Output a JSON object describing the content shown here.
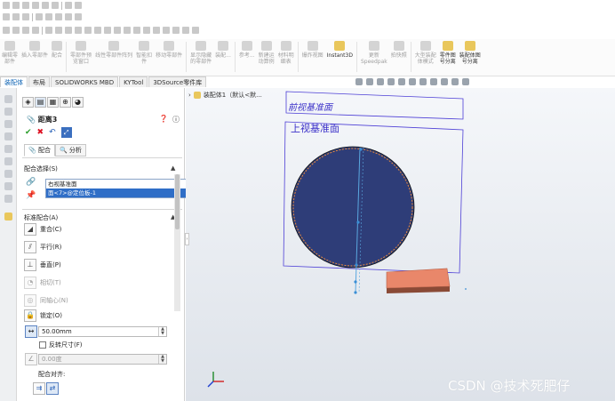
{
  "ribbon": {
    "items": [
      {
        "label": "编辑零\n部件",
        "on": false
      },
      {
        "label": "插入零部件",
        "on": false
      },
      {
        "label": "配合",
        "on": false
      },
      {
        "label": "零部件预\n览窗口",
        "on": false
      },
      {
        "label": "线性零部件阵列",
        "on": false
      },
      {
        "label": "智能扣\n件",
        "on": false
      },
      {
        "label": "移动零部件",
        "on": false
      },
      {
        "label": "显示隐藏\n的零部件",
        "on": false
      },
      {
        "label": "装配...",
        "on": false
      },
      {
        "label": "参考...",
        "on": false
      },
      {
        "label": "新建运\n动算例",
        "on": false
      },
      {
        "label": "材料明\n细表",
        "on": false
      },
      {
        "label": "爆炸视图",
        "on": false
      },
      {
        "label": "Instant3D",
        "on": true
      },
      {
        "label": "更新\nSpeedpak",
        "on": false
      },
      {
        "label": "拍快照",
        "on": false
      },
      {
        "label": "大型装配\n体模式",
        "on": false
      },
      {
        "label": "零件图\n号分离",
        "on": true
      },
      {
        "label": "装配体图\n号分离",
        "on": true
      }
    ]
  },
  "tabs": [
    {
      "label": "装配体",
      "active": true
    },
    {
      "label": "布局",
      "active": false
    },
    {
      "label": "SOLIDWORKS MBD",
      "active": false
    },
    {
      "label": "KYTool",
      "active": false
    },
    {
      "label": "3DSource零件库",
      "active": false
    }
  ],
  "pm": {
    "title": "距离3",
    "subtab_mate": "配合",
    "subtab_analysis": "分析",
    "section_selection": "配合选择(S)",
    "selections": [
      "右视基准面",
      "面<7>@定位板-1"
    ],
    "section_standard": "标准配合(A)",
    "mates": [
      {
        "label": "重合(C)",
        "icon": "◢",
        "disabled": false
      },
      {
        "label": "平行(R)",
        "icon": "⫽",
        "disabled": false
      },
      {
        "label": "垂直(P)",
        "icon": "⊥",
        "disabled": false
      },
      {
        "label": "相切(T)",
        "icon": "◔",
        "disabled": true
      },
      {
        "label": "同轴心(N)",
        "icon": "◎",
        "disabled": true
      },
      {
        "label": "锁定(O)",
        "icon": "🔒",
        "disabled": false
      }
    ],
    "distance_value": "50.00mm",
    "flip_dimension": "反转尺寸(F)",
    "angle_value": "0.00度",
    "alignment_label": "配合对齐:"
  },
  "tree": {
    "label": "装配体1（默认<默..."
  },
  "viewport": {
    "front_plane": "前视基准面",
    "top_plane": "上视基准面"
  },
  "watermark": "CSDN @技术死肥仔",
  "colors": {
    "disc": "#2e3d78",
    "plate": "#e9876a",
    "plane_border": "#4d3fd6"
  }
}
